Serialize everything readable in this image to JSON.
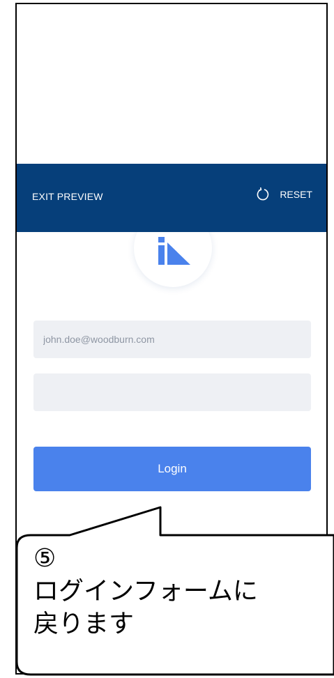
{
  "preview_bar": {
    "exit_label": "EXIT PREVIEW",
    "reset_label": "RESET",
    "reset_icon": "refresh-icon",
    "background": "#063f7a"
  },
  "logo": {
    "icon": "app-logo-icon",
    "color": "#4a82ec"
  },
  "login_form": {
    "email_placeholder": "john.doe@woodburn.com",
    "password_placeholder": "",
    "login_label": "Login",
    "button_color": "#4a82ec"
  },
  "callout": {
    "step": "⑤",
    "line1": "ログインフォームに",
    "line2": "戻ります"
  }
}
